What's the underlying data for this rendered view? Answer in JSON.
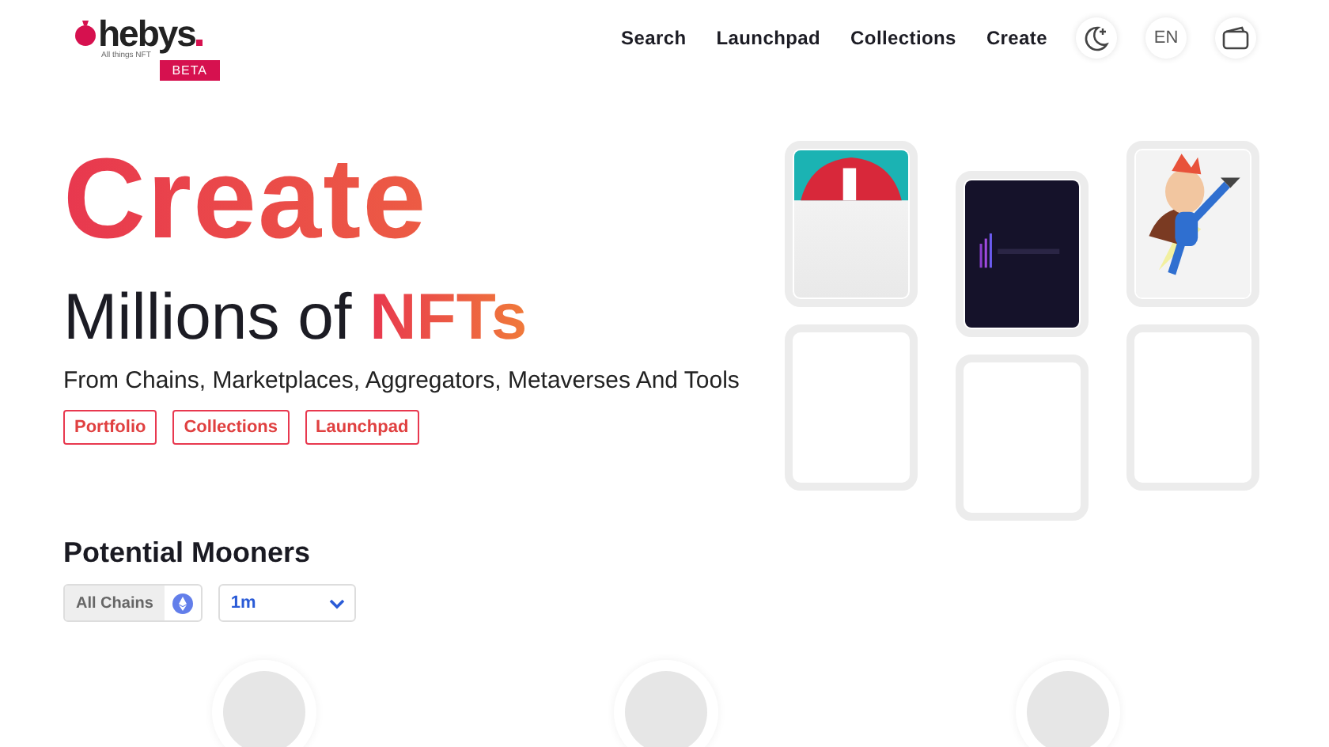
{
  "header": {
    "logo": {
      "name": "hebys",
      "tagline": "All things NFT",
      "badge": "BETA"
    },
    "nav": [
      "Search",
      "Launchpad",
      "Collections",
      "Create"
    ],
    "language": "EN"
  },
  "hero": {
    "title": "Create",
    "subtitle": "Millions of ",
    "subtitle_highlight": "NFTs",
    "description": "From Chains, Marketplaces, Aggregators, Metaverses And Tools",
    "tags": [
      "Portfolio",
      "Collections",
      "Launchpad"
    ],
    "card_columns": [
      [
        {
          "kind": "picture"
        },
        {
          "kind": "empty"
        }
      ],
      [
        {
          "kind": "picture"
        },
        {
          "kind": "empty"
        }
      ],
      [
        {
          "kind": "picture"
        },
        {
          "kind": "empty"
        }
      ]
    ]
  },
  "mooners": {
    "title": "Potential Mooners",
    "chain_filter": "All Chains",
    "period": "1m",
    "placeholders": [
      {
        "kind": "avatar"
      },
      {
        "kind": "avatar"
      },
      {
        "kind": "avatar"
      }
    ]
  }
}
